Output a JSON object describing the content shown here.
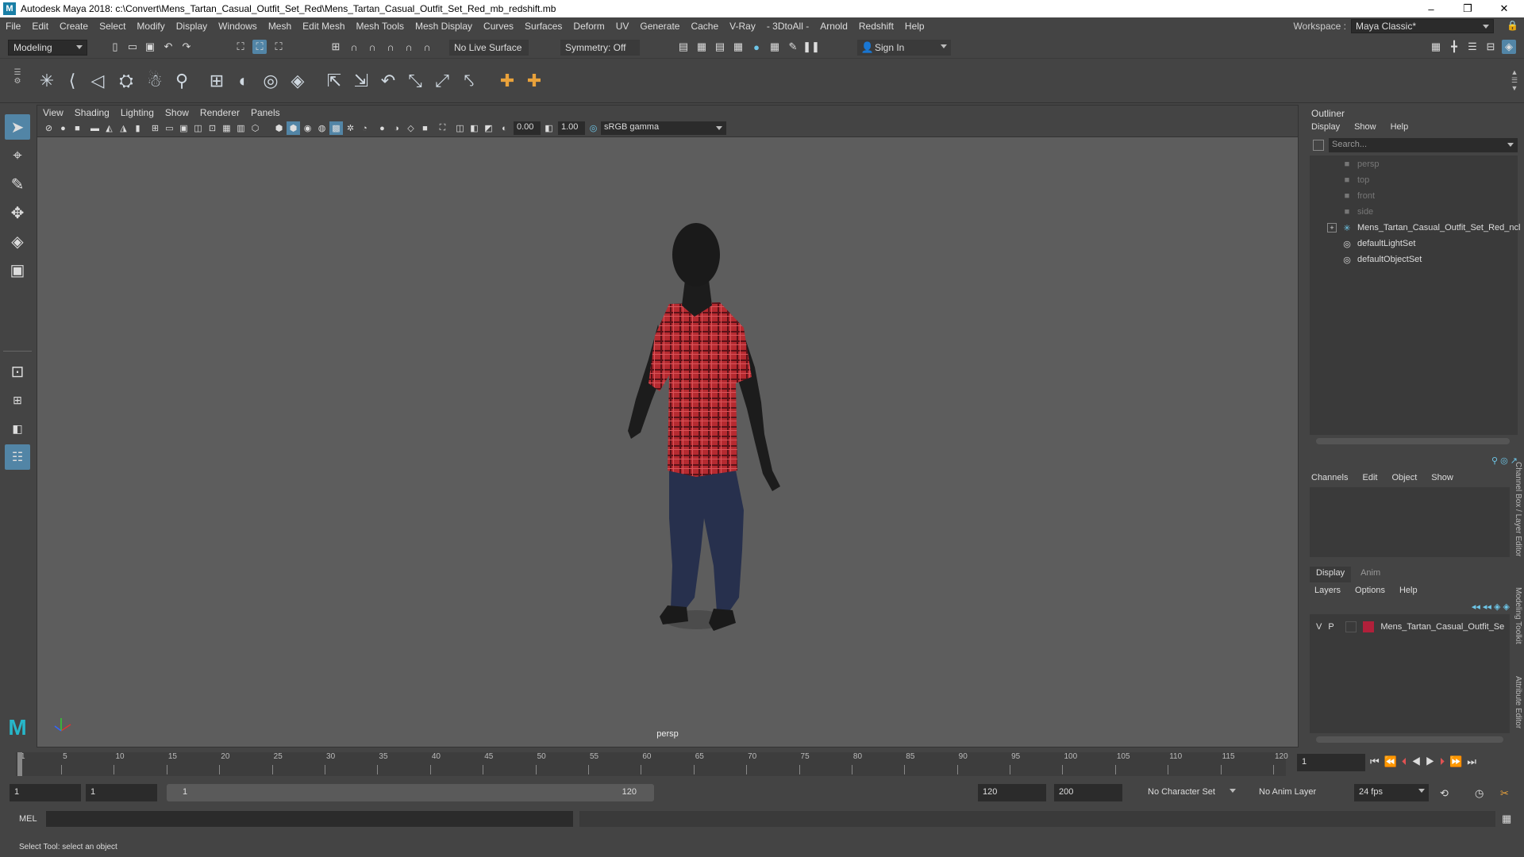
{
  "titlebar": {
    "title": "Autodesk Maya 2018: c:\\Convert\\Mens_Tartan_Casual_Outfit_Set_Red\\Mens_Tartan_Casual_Outfit_Set_Red_mb_redshift.mb",
    "logo": "M",
    "minimize": "–",
    "maximize": "❐",
    "close": "✕"
  },
  "menubar": {
    "items": [
      "File",
      "Edit",
      "Create",
      "Select",
      "Modify",
      "Display",
      "Windows",
      "Mesh",
      "Edit Mesh",
      "Mesh Tools",
      "Mesh Display",
      "Curves",
      "Surfaces",
      "Deform",
      "UV",
      "Generate",
      "Cache",
      "V-Ray",
      "- 3DtoAll -",
      "Arnold",
      "Redshift",
      "Help"
    ],
    "workspace_label": "Workspace :",
    "workspace_value": "Maya Classic*"
  },
  "statusline": {
    "mode": "Modeling",
    "live_surface": "No Live Surface",
    "symmetry": "Symmetry: Off",
    "sign_in": "Sign In"
  },
  "viewport": {
    "menu": [
      "View",
      "Shading",
      "Lighting",
      "Show",
      "Renderer",
      "Panels"
    ],
    "exposure": "0.00",
    "gamma": "1.00",
    "color_space": "sRGB gamma",
    "camera_label": "persp"
  },
  "outliner": {
    "title": "Outliner",
    "menu": [
      "Display",
      "Show",
      "Help"
    ],
    "search_placeholder": "Search...",
    "items": [
      {
        "label": "persp",
        "icon": "camera-icon",
        "dim": true
      },
      {
        "label": "top",
        "icon": "camera-icon",
        "dim": true
      },
      {
        "label": "front",
        "icon": "camera-icon",
        "dim": true
      },
      {
        "label": "side",
        "icon": "camera-icon",
        "dim": true
      },
      {
        "label": "Mens_Tartan_Casual_Outfit_Set_Red_ncl",
        "icon": "group-icon",
        "dim": false
      },
      {
        "label": "defaultLightSet",
        "icon": "set-icon",
        "dim": false
      },
      {
        "label": "defaultObjectSet",
        "icon": "set-icon",
        "dim": false
      }
    ]
  },
  "channelbox": {
    "menu": [
      "Channels",
      "Edit",
      "Object",
      "Show"
    ]
  },
  "layereditor": {
    "tabs": [
      "Display",
      "Anim"
    ],
    "menu": [
      "Layers",
      "Options",
      "Help"
    ],
    "layer": {
      "v": "V",
      "p": "P",
      "name": "Mens_Tartan_Casual_Outfit_Se",
      "color": "#b0203a"
    }
  },
  "side_tabs": [
    "Channel Box / Layer Editor",
    "Modeling Toolkit",
    "Attribute Editor"
  ],
  "timeline": {
    "ticks": [
      "1",
      "5",
      "10",
      "15",
      "20",
      "25",
      "30",
      "35",
      "40",
      "45",
      "50",
      "55",
      "60",
      "65",
      "70",
      "75",
      "80",
      "85",
      "90",
      "95",
      "100",
      "105",
      "110",
      "115",
      "120"
    ],
    "current_frame": "1"
  },
  "range": {
    "start": "1",
    "playback_start": "1",
    "slider_start": "1",
    "slider_end": "120",
    "playback_end": "120",
    "end": "200",
    "character_set": "No Character Set",
    "anim_layer": "No Anim Layer",
    "fps": "24 fps"
  },
  "cmdline": {
    "label": "MEL"
  },
  "helpline": {
    "text": "Select Tool: select an object"
  },
  "colors": {
    "tartan": "#b62a30",
    "jeans": "#27304d",
    "skin": "#1c1c1c"
  }
}
